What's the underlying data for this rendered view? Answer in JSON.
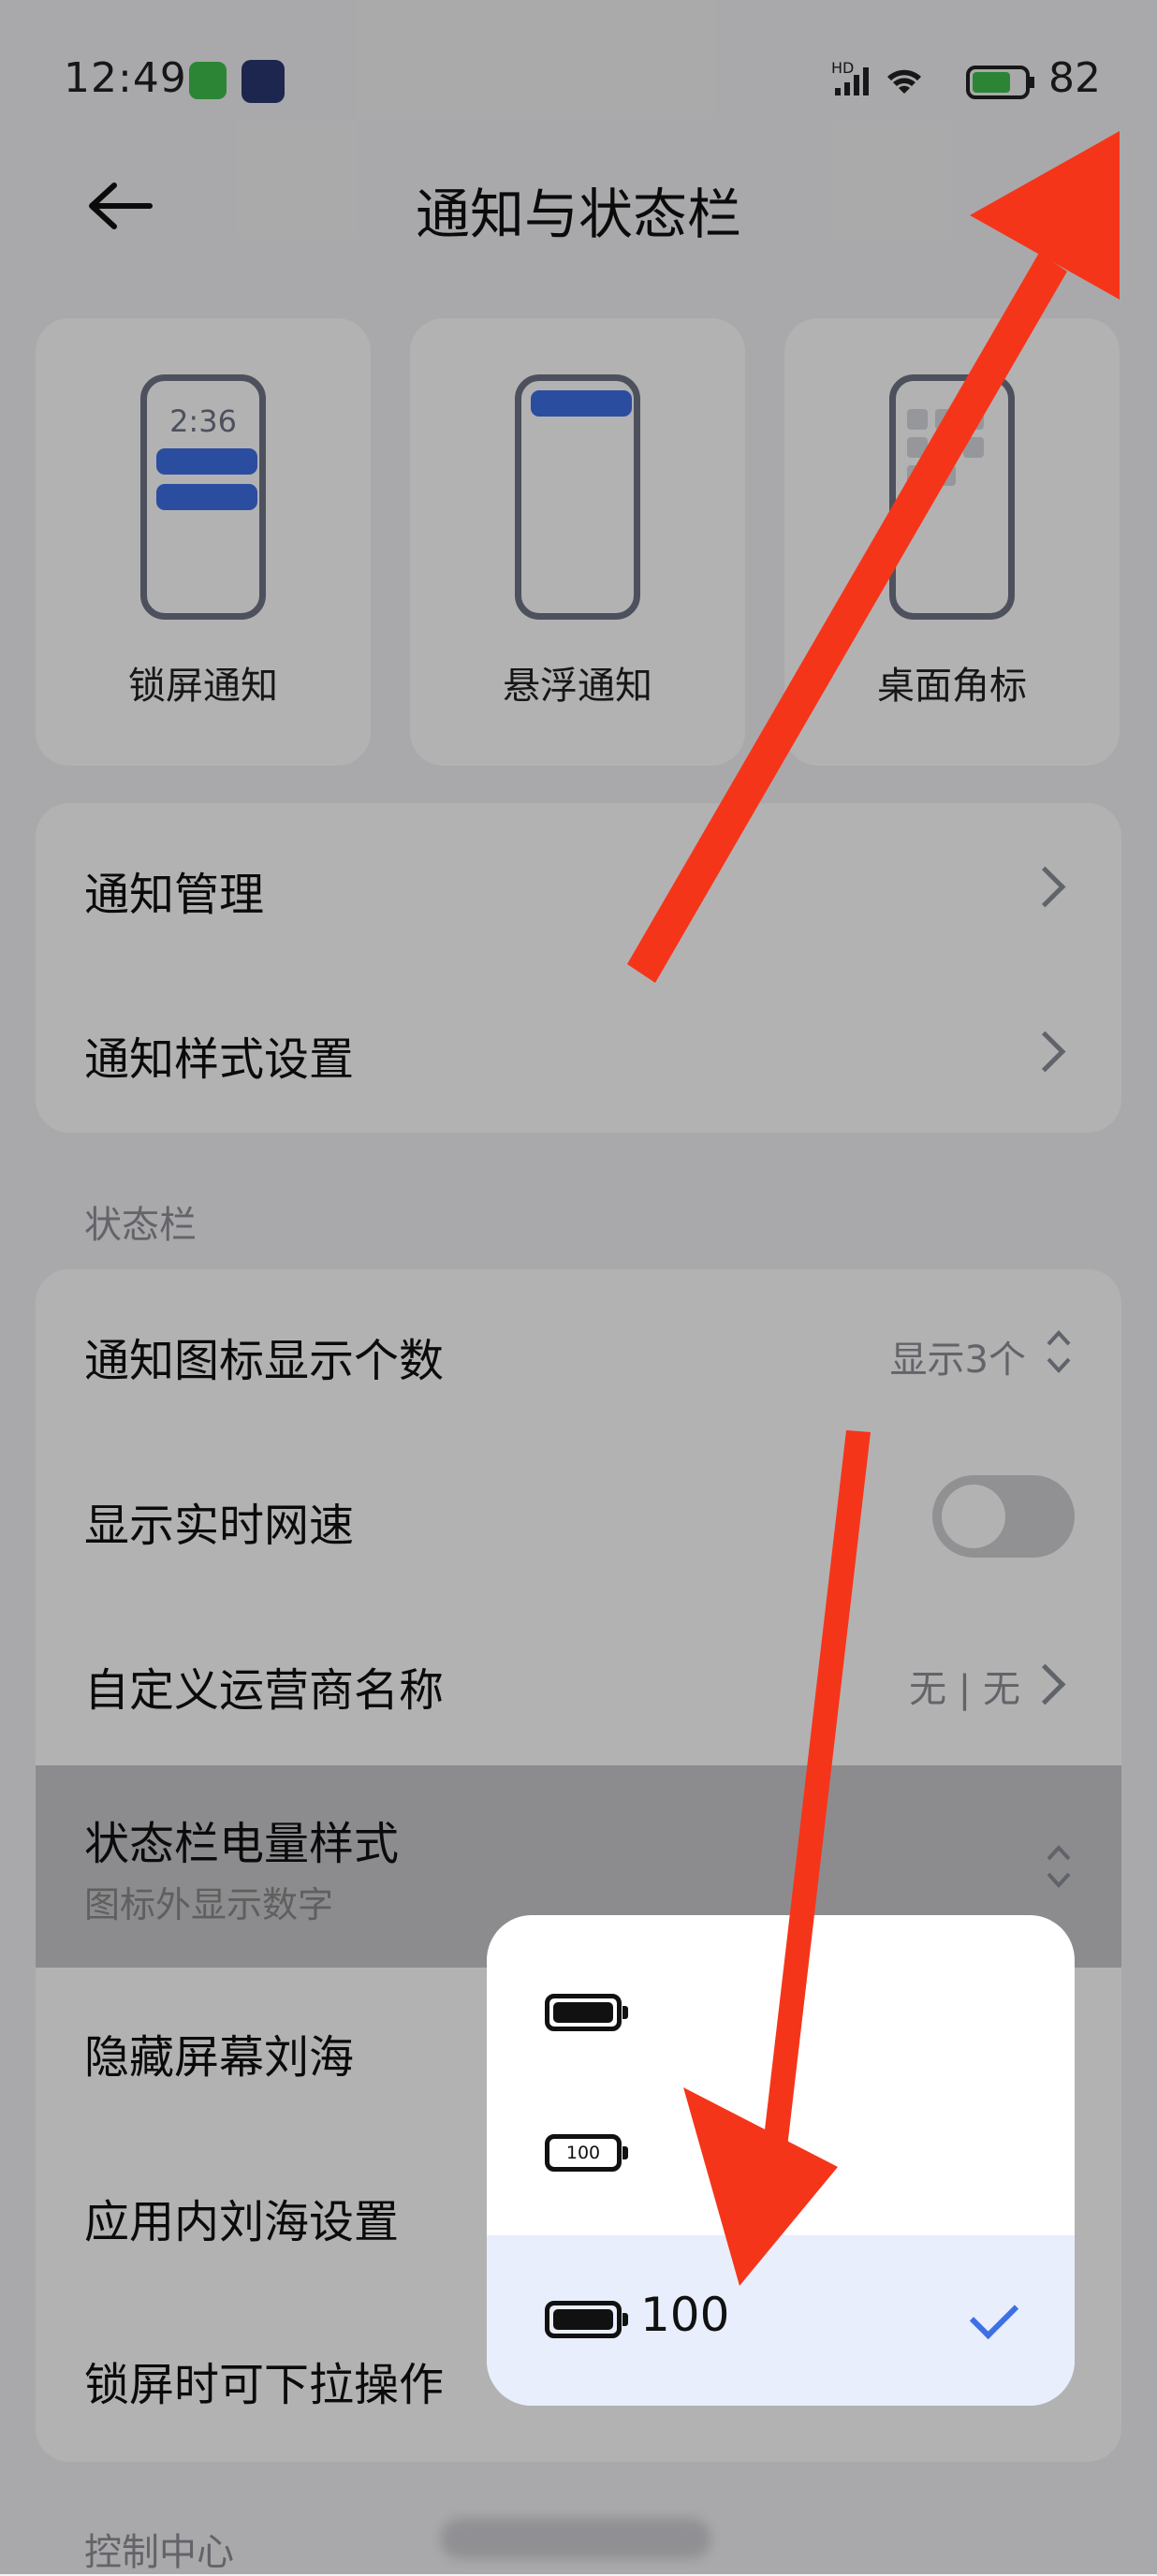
{
  "status_bar": {
    "time": "12:49",
    "battery": "82",
    "network_label": "HD"
  },
  "header": {
    "title": "通知与状态栏"
  },
  "tiles": [
    {
      "label": "锁屏通知",
      "preview_time": "2:36"
    },
    {
      "label": "悬浮通知"
    },
    {
      "label": "桌面角标"
    }
  ],
  "notification_section": {
    "items": [
      {
        "label": "通知管理"
      },
      {
        "label": "通知样式设置"
      }
    ]
  },
  "status_bar_section": {
    "header": "状态栏",
    "notif_icon_count": {
      "label": "通知图标显示个数",
      "value": "显示3个"
    },
    "realtime_speed": {
      "label": "显示实时网速",
      "enabled": false
    },
    "carrier_name": {
      "label": "自定义运营商名称",
      "value": "无 | 无"
    },
    "battery_style": {
      "label": "状态栏电量样式",
      "subtitle": "图标外显示数字"
    },
    "hide_notch": {
      "label": "隐藏屏幕刘海"
    },
    "in_app_notch": {
      "label": "应用内刘海设置"
    },
    "lockscreen_pulldown": {
      "label": "锁屏时可下拉操作"
    }
  },
  "control_center": {
    "header": "控制中心"
  },
  "battery_popup": {
    "options": [
      {
        "icon": "battery-filled-icon",
        "text": ""
      },
      {
        "icon": "battery-number-inside-icon",
        "inner_text": "100"
      },
      {
        "icon": "battery-filled-icon",
        "text": "100",
        "selected": true
      }
    ]
  },
  "colors": {
    "accent": "#3e6fe6",
    "arrow": "#f5351a",
    "background": "#f3f3f5"
  }
}
